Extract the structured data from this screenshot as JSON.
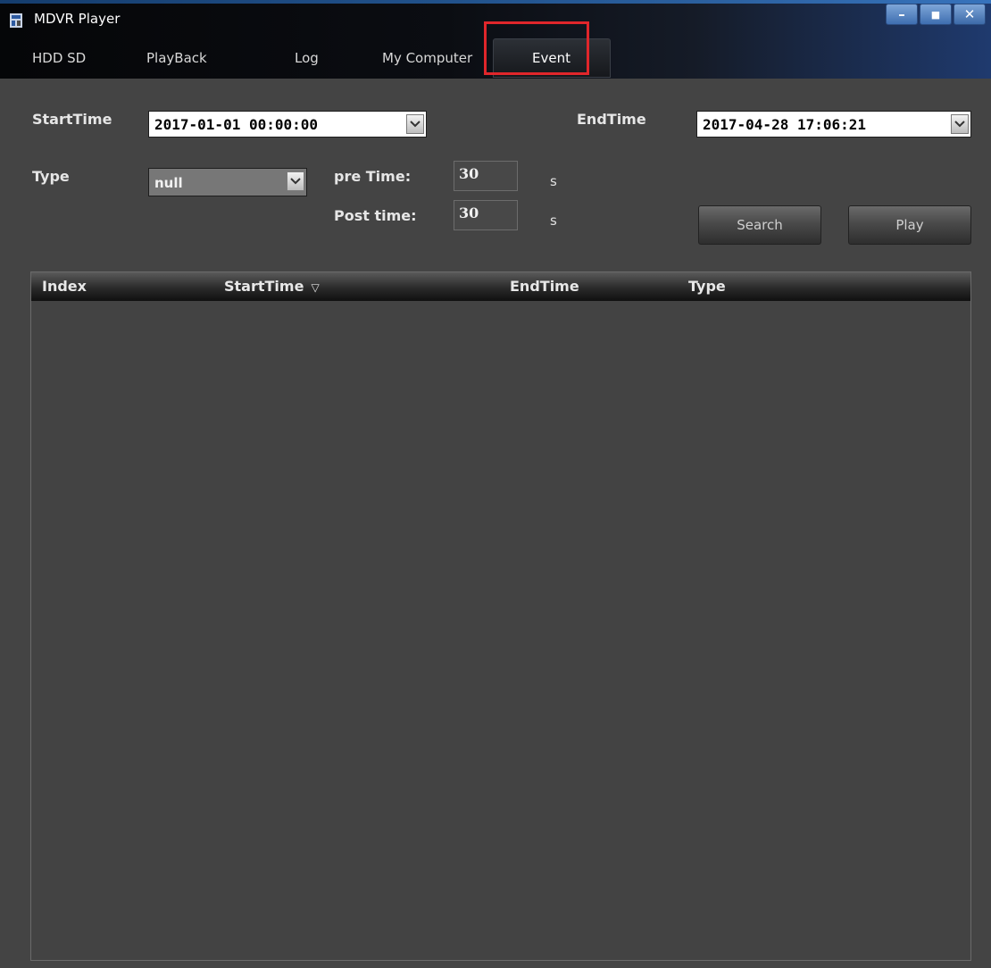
{
  "window": {
    "title": "MDVR Player",
    "controls": {
      "minimize": "–",
      "maximize": "■",
      "close": "✕"
    }
  },
  "tabs": [
    {
      "label": "HDD SD"
    },
    {
      "label": "PlayBack"
    },
    {
      "label": "Log"
    },
    {
      "label": "My Computer"
    },
    {
      "label": "Event",
      "active": true,
      "highlighted": true
    }
  ],
  "form": {
    "start_time_label": "StartTime",
    "start_time_value": "2017-01-01 00:00:00",
    "end_time_label": "EndTime",
    "end_time_value": "2017-04-28 17:06:21",
    "type_label": "Type",
    "type_value": "null",
    "pre_time_label": "pre Time:",
    "pre_time_value": "30",
    "pre_time_unit": "s",
    "post_time_label": "Post time:",
    "post_time_value": "30",
    "post_time_unit": "s",
    "search_button": "Search",
    "play_button": "Play"
  },
  "table": {
    "columns": [
      "Index",
      "StartTime",
      "EndTime",
      "Type"
    ],
    "sorted_column": "StartTime",
    "sort_indicator": "▽",
    "rows": []
  },
  "colors": {
    "background": "#444444",
    "highlight": "#e0262b",
    "titlebar_accent": "#3f86d6"
  }
}
